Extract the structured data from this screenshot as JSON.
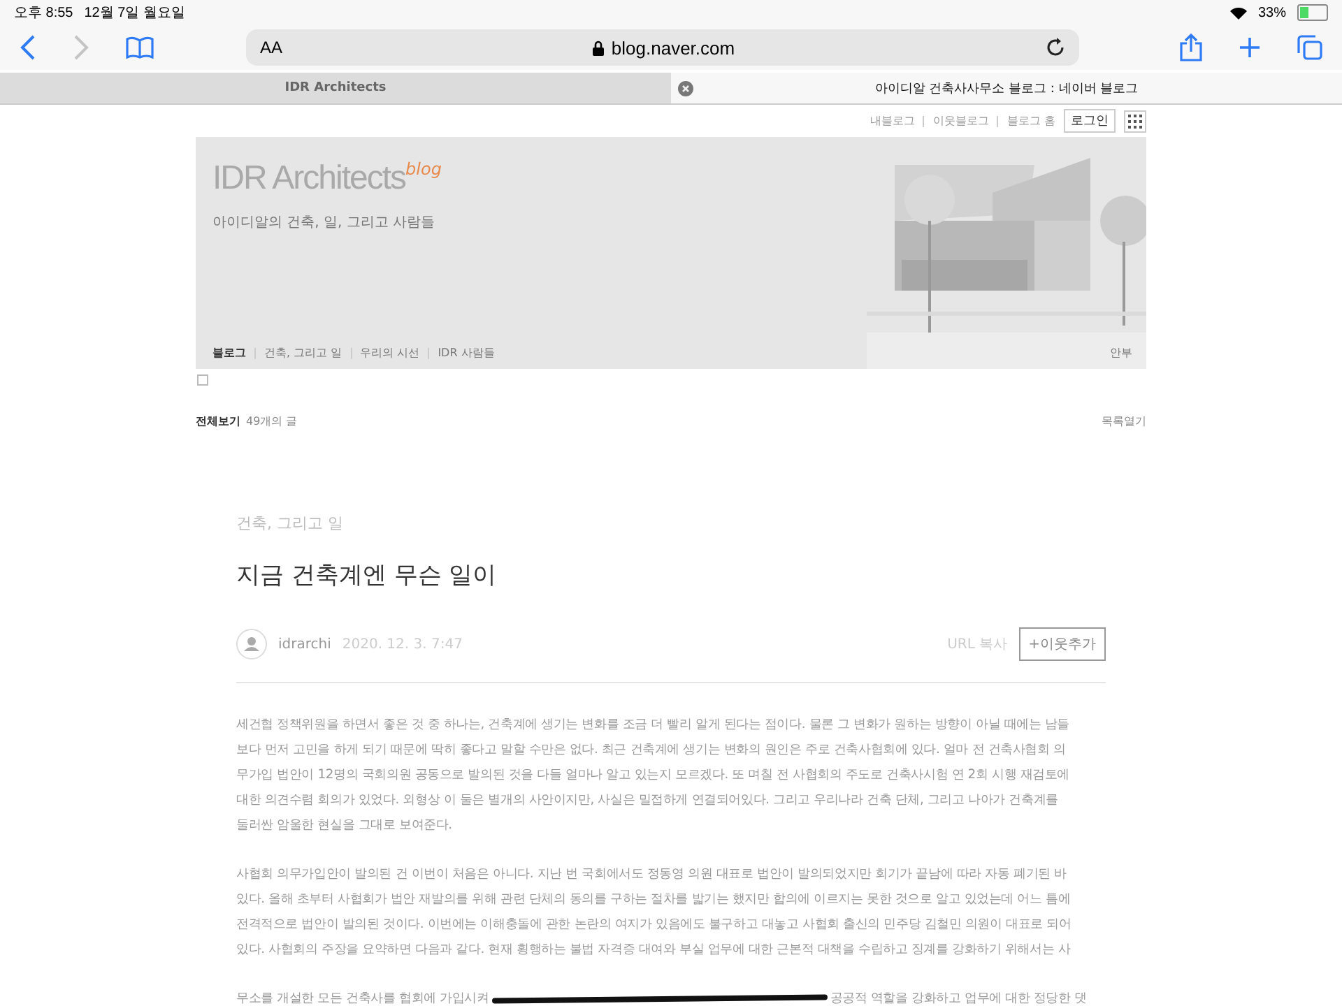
{
  "status_bar": {
    "time": "오후 8:55",
    "date": "12월 7일 월요일",
    "battery_text": "33%"
  },
  "toolbar": {
    "text_size": "AA",
    "url": "blog.naver.com"
  },
  "tabs": [
    {
      "title": "IDR Architects",
      "selected": false
    },
    {
      "title": "아이디알 건축사사무소 블로그 : 네이버 블로그",
      "selected": true
    }
  ],
  "top_links": [
    "내블로그",
    "이웃블로그",
    "블로그 홈"
  ],
  "login": "로그인",
  "banner": {
    "title": "IDR Architects",
    "title_badge": "blog",
    "subtitle": "아이디알의 건축, 일, 그리고 사람들",
    "menu": [
      {
        "label": "블로그",
        "selected": true
      },
      {
        "label": "건축, 그리고 일",
        "selected": false
      },
      {
        "label": "우리의 시선",
        "selected": false
      },
      {
        "label": "IDR 사람들",
        "selected": false
      }
    ],
    "guestbook": "안부"
  },
  "list_bar": {
    "all": "전체보기",
    "count": "49개의 글",
    "toggle": "목록열기"
  },
  "post": {
    "category": "건축, 그리고 일",
    "title": "지금 건축계엔 무슨 일이",
    "author": "idrarchi",
    "date": "2020. 12. 3. 7:47",
    "url_copy": "URL 복사",
    "add_neighbor": "+이웃추가",
    "paragraphs": [
      [
        "세건협 정책위원을 하면서 좋은 것 중 하나는, 건축계에 생기는 변화를 조금 더 빨리 알게 된다는 점이다. 물론 그 변화가 원하는 방향이 아닐 때에는 남들",
        "보다 먼저 고민을 하게 되기 때문에 딱히 좋다고 말할 수만은 없다. 최근 건축계에 생기는 변화의 원인은 주로 건축사협회에 있다. 얼마 전 건축사협회 의",
        "무가입 법안이 12명의 국회의원 공동으로 발의된 것을 다들 얼마나 알고 있는지 모르겠다. 또 며칠 전 사협회의 주도로 건축사시험 연 2회 시행 재검토에",
        "대한 의견수렴 회의가 있었다. 외형상 이 둘은 별개의 사안이지만, 사실은 밀접하게 연결되어있다. 그리고 우리나라 건축 단체, 그리고 나아가 건축계를",
        "둘러싼 암울한 현실을 그대로 보여준다."
      ],
      [
        "사협회 의무가입안이 발의된 건 이번이 처음은 아니다. 지난 번 국회에서도 정동영 의원 대표로 법안이 발의되었지만 회기가 끝남에 따라 자동 폐기된 바",
        "있다. 올해 초부터 사협회가 법안 재발의를 위해 관련 단체의 동의를 구하는 절차를 밟기는 했지만 합의에 이르지는 못한 것으로 알고 있었는데 어느 틈에",
        "전격적으로 법안이 발의된 것이다. 이번에는 이해충돌에 관한 논란의 여지가 있음에도 불구하고 대놓고 사협회 출신의 민주당 김철민 의원이 대표로 되어",
        "있다. 사협회의 주장을 요약하면 다음과 같다. 현재 횡행하는 불법 자격증 대여와 부실 업무에 대한 근본적 대책을 수립하고 징계를 강화하기 위해서는 사"
      ]
    ],
    "redacted_line": {
      "before": "무소를 개설한 모든 건축사를 협회에 가입시켜",
      "after": "공공적 역할을 강화하고 업무에 대한 정당한 댓"
    }
  }
}
